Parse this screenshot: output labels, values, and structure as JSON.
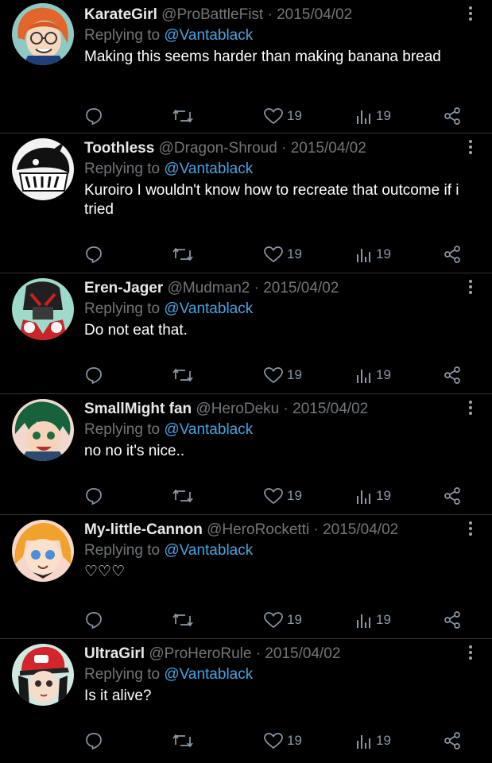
{
  "replies": [
    {
      "name": "KarateGirl",
      "handle": "@ProBattleFist",
      "separator": "·",
      "date": "2015/04/02",
      "replying_prefix": "Replying to",
      "replying_to": "@Vantablack",
      "text": "Making this seems harder than making banana bread",
      "likes": "19",
      "views": "19",
      "avatar_icon": "anime-girl-orange-hair-avatar"
    },
    {
      "name": "Toothless",
      "handle": "@Dragon-Shroud",
      "separator": "·",
      "date": "2015/04/02",
      "replying_prefix": "Replying to",
      "replying_to": "@Vantablack",
      "text": "Kuroiro I wouldn't know how to recreate that outcome if i tried",
      "likes": "19",
      "views": "19",
      "avatar_icon": "manga-mask-avatar"
    },
    {
      "name": "Eren-Jager",
      "handle": "@Mudman2",
      "separator": "·",
      "date": "2015/04/02",
      "replying_prefix": "Replying to",
      "replying_to": "@Vantablack",
      "text": "Do not eat that.",
      "likes": "19",
      "views": "19",
      "avatar_icon": "armored-hero-avatar"
    },
    {
      "name": "SmallMight fan",
      "handle": "@HeroDeku",
      "separator": "·",
      "date": "2015/04/02",
      "replying_prefix": "Replying to",
      "replying_to": "@Vantablack",
      "text": "no no it's nice..",
      "likes": "19",
      "views": "19",
      "avatar_icon": "green-hair-hero-avatar"
    },
    {
      "name": "My-little-Cannon",
      "handle": "@HeroRocketti",
      "separator": "·",
      "date": "2015/04/02",
      "replying_prefix": "Replying to",
      "replying_to": "@Vantablack",
      "text": "♡♡♡",
      "likes": "19",
      "views": "19",
      "avatar_icon": "blonde-girl-avatar"
    },
    {
      "name": "UltraGirl",
      "handle": "@ProHeroRule",
      "separator": "·",
      "date": "2015/04/02",
      "replying_prefix": "Replying to",
      "replying_to": "@Vantablack",
      "text": "Is it alive?",
      "likes": "19",
      "views": "19",
      "avatar_icon": "red-cap-girl-avatar"
    }
  ],
  "colors": {
    "background": "#000000",
    "name": "#e7e9ea",
    "muted": "#71767b",
    "mention": "#4aa3df",
    "divider": "#2f3336"
  }
}
